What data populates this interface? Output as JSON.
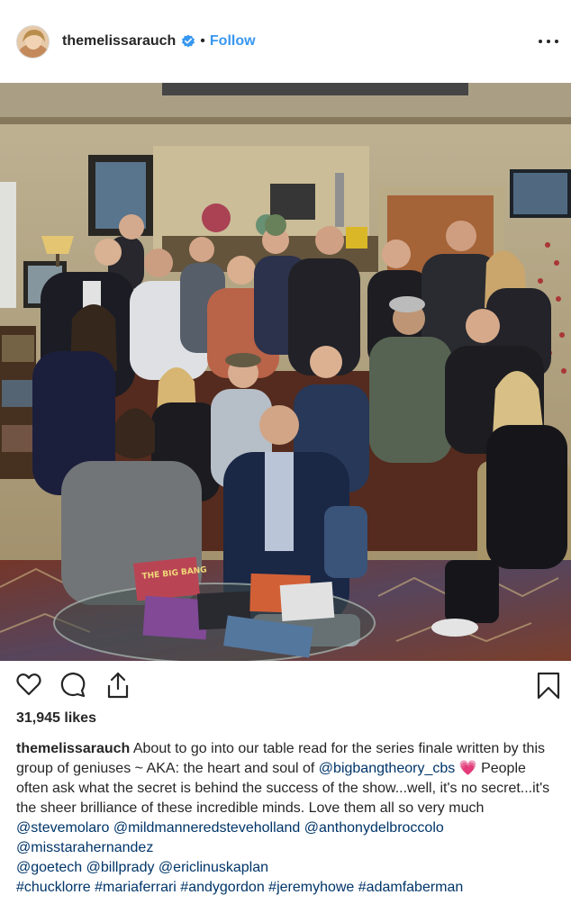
{
  "header": {
    "username": "themelissarauch",
    "separator": "•",
    "follow_label": "Follow",
    "verified_icon": "verified-badge-icon",
    "more_icon": "more-options-icon"
  },
  "photo": {
    "subject": "cast-group-photo",
    "magazine_title": "THE BIG BANG"
  },
  "actions": {
    "like_icon": "heart-icon",
    "comment_icon": "comment-icon",
    "share_icon": "share-icon",
    "save_icon": "bookmark-icon"
  },
  "likes": {
    "text": "31,945 likes"
  },
  "caption": {
    "username": "themelissarauch",
    "text_1": " About to go into our table read for the series finale written by this group of geniuses ~ AKA: the heart and soul of ",
    "mention_1": "@bigbangtheory_cbs",
    "emoji": "💗",
    "text_2": " People often ask what the secret is behind the success of the show...well, it's no secret...it's the sheer brilliance of these incredible minds. Love them all so very much ",
    "mentions": [
      "@stevemolaro",
      "@mildmanneredsteveholland",
      "@anthonydelbroccolo",
      "@misstarahernandez",
      "@goetech",
      "@billprady",
      "@ericlinuskaplan"
    ],
    "hashtags": [
      "#chucklorre",
      "#mariaferrari",
      "#andygordon",
      "#jeremyhowe",
      "#adamfaberman"
    ]
  },
  "colors": {
    "link": "#003569",
    "follow": "#3897f0",
    "text": "#262626",
    "heart": "#e8488c"
  }
}
